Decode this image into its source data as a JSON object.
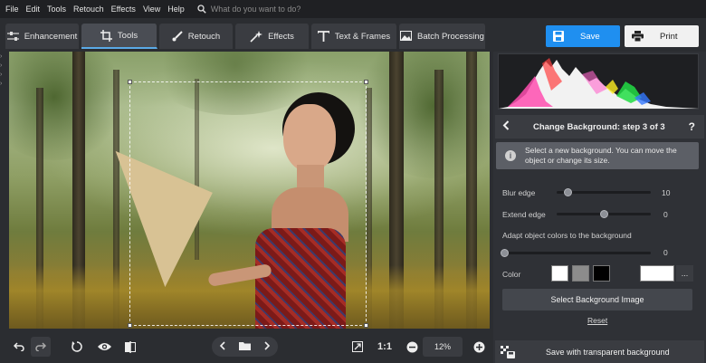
{
  "menu": {
    "items": [
      "File",
      "Edit",
      "Tools",
      "Retouch",
      "Effects",
      "View",
      "Help"
    ],
    "search_placeholder": "What do you want to do?"
  },
  "tabs": [
    {
      "label": "Enhancement",
      "icon": "sliders-icon"
    },
    {
      "label": "Tools",
      "icon": "crop-icon",
      "active": true
    },
    {
      "label": "Retouch",
      "icon": "brush-icon"
    },
    {
      "label": "Effects",
      "icon": "sparkle-icon"
    },
    {
      "label": "Text & Frames",
      "icon": "text-icon"
    },
    {
      "label": "Batch Processing",
      "icon": "images-icon"
    }
  ],
  "actions": {
    "save_label": "Save",
    "print_label": "Print"
  },
  "bottom": {
    "ratio_label": "1:1",
    "zoom": "12%"
  },
  "panel": {
    "step_title": "Change Background: step 3 of 3",
    "help": "?",
    "info_text": "Select a new background. You can move the object or change its size.",
    "blur_label": "Blur edge",
    "blur_value": "10",
    "blur_fraction": 0.12,
    "extend_label": "Extend edge",
    "extend_value": "0",
    "extend_fraction": 0.5,
    "adapt_label": "Adapt object colors to the background",
    "adapt_value": "0",
    "adapt_fraction": 0.0,
    "color_label": "Color",
    "swatches": [
      "#ffffff",
      "#8c8c8c",
      "#000000"
    ],
    "custom_swatch": "#ffffff",
    "more_label": "...",
    "select_bg_label": "Select Background Image",
    "reset_label": "Reset",
    "transparent_label": "Save with transparent background"
  },
  "colors": {
    "accent": "#1f8ff0",
    "background": "#2b2d31",
    "panel": "#2f3136"
  }
}
